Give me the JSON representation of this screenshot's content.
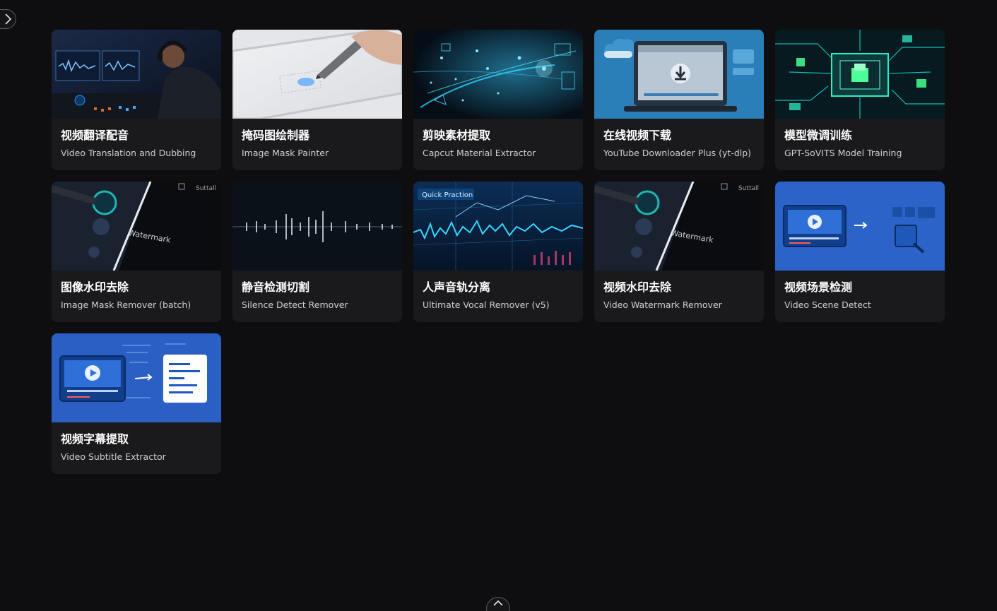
{
  "sidebar": {
    "toggle_icon": "chevron-right-icon"
  },
  "cards": [
    {
      "title": "视频翻译配音",
      "subtitle": "Video Translation and Dubbing",
      "thumbnail": "studio-mixing-desk"
    },
    {
      "title": "掩码图绘制器",
      "subtitle": "Image Mask Painter",
      "thumbnail": "stylus-on-tablet"
    },
    {
      "title": "剪映素材提取",
      "subtitle": "Capcut Material Extractor",
      "thumbnail": "data-particles"
    },
    {
      "title": "在线视频下载",
      "subtitle": "YouTube Downloader Plus (yt-dlp)",
      "thumbnail": "laptop-download"
    },
    {
      "title": "模型微调训练",
      "subtitle": "GPT-SoVITS Model Training",
      "thumbnail": "circuit-chip"
    },
    {
      "title": "图像水印去除",
      "subtitle": "Image Mask Remover (batch)",
      "thumbnail": "watermark-panel",
      "thumb_text": [
        "Watermark",
        "Suttall"
      ]
    },
    {
      "title": "静音检测切割",
      "subtitle": "Silence Detect Remover",
      "thumbnail": "audio-waveform"
    },
    {
      "title": "人声音轨分离",
      "subtitle": "Ultimate Vocal Remover (v5)",
      "thumbnail": "spectrum-display",
      "thumb_text": [
        "Quick Praction"
      ]
    },
    {
      "title": "视频水印去除",
      "subtitle": "Video Watermark Remover",
      "thumbnail": "watermark-panel",
      "thumb_text": [
        "Watermark",
        "Suttall"
      ]
    },
    {
      "title": "视频场景检测",
      "subtitle": "Video Scene Detect",
      "thumbnail": "scene-detect"
    },
    {
      "title": "视频字幕提取",
      "subtitle": "Video Subtitle Extractor",
      "thumbnail": "subtitle-extract"
    }
  ],
  "footer": {
    "scroll_top_icon": "chevron-up-icon"
  },
  "colors": {
    "background": "#0e0e10",
    "card": "#1a1a1d",
    "accent_blue": "#2a6fd6"
  }
}
